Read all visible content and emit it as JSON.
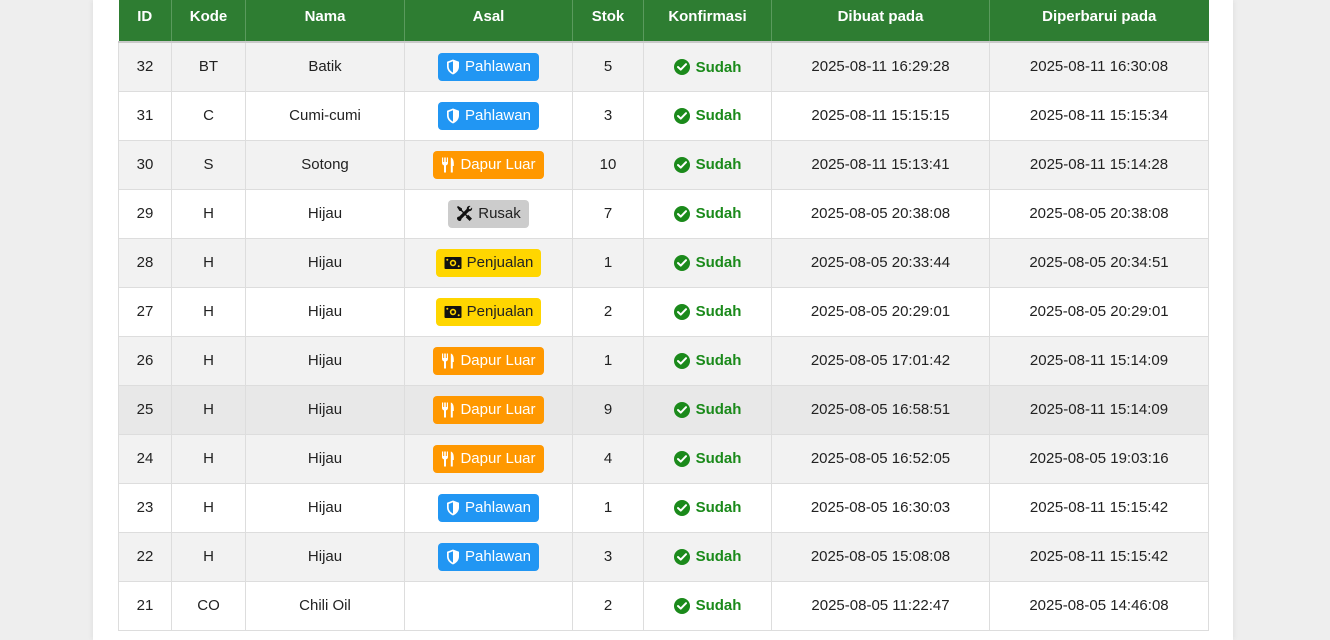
{
  "colors": {
    "header_bg": "#2e7d32",
    "pahlawan": "#2196f3",
    "dapur_luar": "#ff9800",
    "rusak": "#cccccc",
    "penjualan": "#ffd600",
    "confirmed": "#1b8a1b"
  },
  "table": {
    "headers": [
      "ID",
      "Kode",
      "Nama",
      "Asal",
      "Stok",
      "Konfirmasi",
      "Dibuat pada",
      "Diperbarui pada"
    ],
    "rows": [
      {
        "id": "32",
        "kode": "BT",
        "nama": "Batik",
        "asal": "Pahlawan",
        "asal_type": "pahlawan",
        "asal_icon": "shield-icon",
        "stok": "5",
        "konfirmasi": "Sudah",
        "dibuat": "2025-08-11 16:29:28",
        "diperbarui": "2025-08-11 16:30:08"
      },
      {
        "id": "31",
        "kode": "C",
        "nama": "Cumi-cumi",
        "asal": "Pahlawan",
        "asal_type": "pahlawan",
        "asal_icon": "shield-icon",
        "stok": "3",
        "konfirmasi": "Sudah",
        "dibuat": "2025-08-11 15:15:15",
        "diperbarui": "2025-08-11 15:15:34"
      },
      {
        "id": "30",
        "kode": "S",
        "nama": "Sotong",
        "asal": "Dapur Luar",
        "asal_type": "dapur",
        "asal_icon": "utensils-icon",
        "stok": "10",
        "konfirmasi": "Sudah",
        "dibuat": "2025-08-11 15:13:41",
        "diperbarui": "2025-08-11 15:14:28"
      },
      {
        "id": "29",
        "kode": "H",
        "nama": "Hijau",
        "asal": "Rusak",
        "asal_type": "rusak",
        "asal_icon": "tools-icon",
        "stok": "7",
        "konfirmasi": "Sudah",
        "dibuat": "2025-08-05 20:38:08",
        "diperbarui": "2025-08-05 20:38:08"
      },
      {
        "id": "28",
        "kode": "H",
        "nama": "Hijau",
        "asal": "Penjualan",
        "asal_type": "penjualan",
        "asal_icon": "money-icon",
        "stok": "1",
        "konfirmasi": "Sudah",
        "dibuat": "2025-08-05 20:33:44",
        "diperbarui": "2025-08-05 20:34:51"
      },
      {
        "id": "27",
        "kode": "H",
        "nama": "Hijau",
        "asal": "Penjualan",
        "asal_type": "penjualan",
        "asal_icon": "money-icon",
        "stok": "2",
        "konfirmasi": "Sudah",
        "dibuat": "2025-08-05 20:29:01",
        "diperbarui": "2025-08-05 20:29:01"
      },
      {
        "id": "26",
        "kode": "H",
        "nama": "Hijau",
        "asal": "Dapur Luar",
        "asal_type": "dapur",
        "asal_icon": "utensils-icon",
        "stok": "1",
        "konfirmasi": "Sudah",
        "dibuat": "2025-08-05 17:01:42",
        "diperbarui": "2025-08-11 15:14:09"
      },
      {
        "id": "25",
        "kode": "H",
        "nama": "Hijau",
        "asal": "Dapur Luar",
        "asal_type": "dapur",
        "asal_icon": "utensils-icon",
        "stok": "9",
        "konfirmasi": "Sudah",
        "dibuat": "2025-08-05 16:58:51",
        "diperbarui": "2025-08-11 15:14:09"
      },
      {
        "id": "24",
        "kode": "H",
        "nama": "Hijau",
        "asal": "Dapur Luar",
        "asal_type": "dapur",
        "asal_icon": "utensils-icon",
        "stok": "4",
        "konfirmasi": "Sudah",
        "dibuat": "2025-08-05 16:52:05",
        "diperbarui": "2025-08-05 19:03:16"
      },
      {
        "id": "23",
        "kode": "H",
        "nama": "Hijau",
        "asal": "Pahlawan",
        "asal_type": "pahlawan",
        "asal_icon": "shield-icon",
        "stok": "1",
        "konfirmasi": "Sudah",
        "dibuat": "2025-08-05 16:30:03",
        "diperbarui": "2025-08-11 15:15:42"
      },
      {
        "id": "22",
        "kode": "H",
        "nama": "Hijau",
        "asal": "Pahlawan",
        "asal_type": "pahlawan",
        "asal_icon": "shield-icon",
        "stok": "3",
        "konfirmasi": "Sudah",
        "dibuat": "2025-08-05 15:08:08",
        "diperbarui": "2025-08-11 15:15:42"
      },
      {
        "id": "21",
        "kode": "CO",
        "nama": "Chili Oil",
        "asal": "",
        "asal_type": "",
        "asal_icon": "",
        "stok": "2",
        "konfirmasi": "Sudah",
        "dibuat": "2025-08-05 11:22:47",
        "diperbarui": "2025-08-05 14:46:08"
      }
    ]
  }
}
